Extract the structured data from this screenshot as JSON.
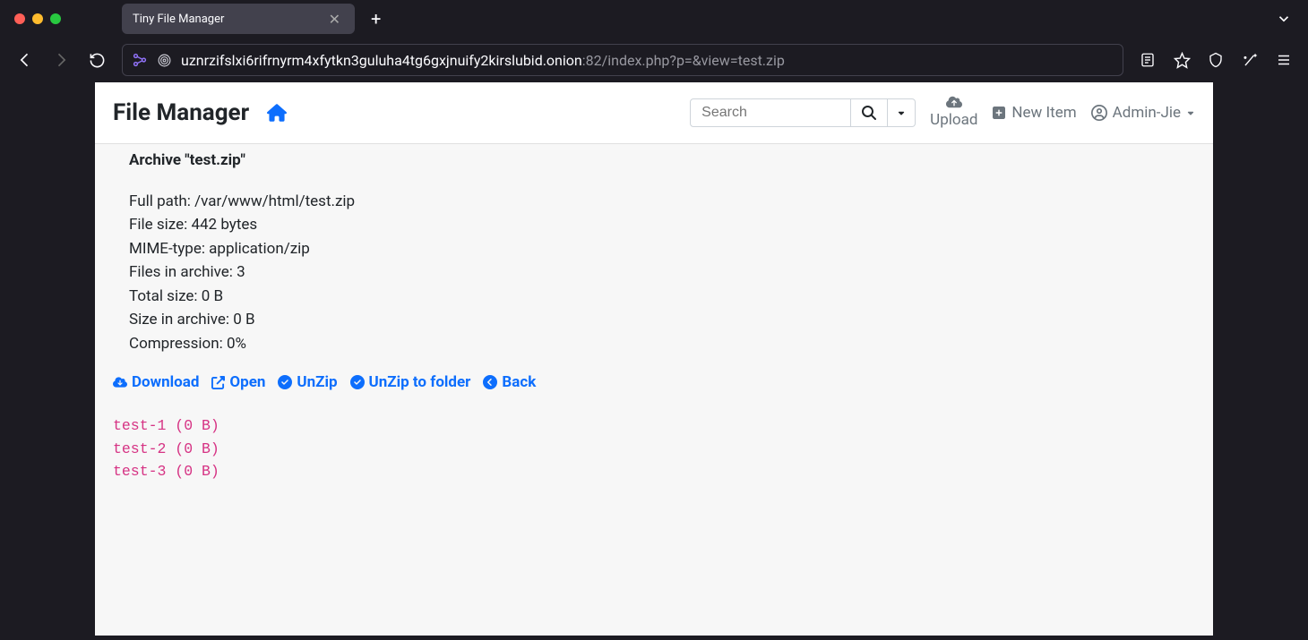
{
  "browser": {
    "tab_title": "Tiny File Manager",
    "url_domain": "uznrzifslxi6rifrnyrm4xfytkn3guluha4tg6gxjnuify2kirslubid.onion",
    "url_rest": ":82/index.php?p=&view=test.zip"
  },
  "header": {
    "brand": "File Manager",
    "search_placeholder": "Search",
    "upload_label": "Upload",
    "new_item_label": "New Item",
    "user_label": "Admin-Jie"
  },
  "archive": {
    "title": "Archive \"test.zip\"",
    "full_path_label": "Full path: ",
    "full_path_value": "/var/www/html/test.zip",
    "file_size_label": "File size: ",
    "file_size_value": "442 bytes",
    "mime_label": "MIME-type: ",
    "mime_value": "application/zip",
    "files_in_archive_label": "Files in archive: ",
    "files_in_archive_value": "3",
    "total_size_label": "Total size: ",
    "total_size_value": "0 B",
    "size_in_archive_label": "Size in archive: ",
    "size_in_archive_value": "0 B",
    "compression_label": "Compression: ",
    "compression_value": "0%"
  },
  "actions": {
    "download": "Download",
    "open": "Open",
    "unzip": "UnZip",
    "unzip_folder": "UnZip to folder",
    "back": "Back"
  },
  "contents": [
    "test-1 (0 B)",
    "test-2 (0 B)",
    "test-3 (0 B)"
  ]
}
